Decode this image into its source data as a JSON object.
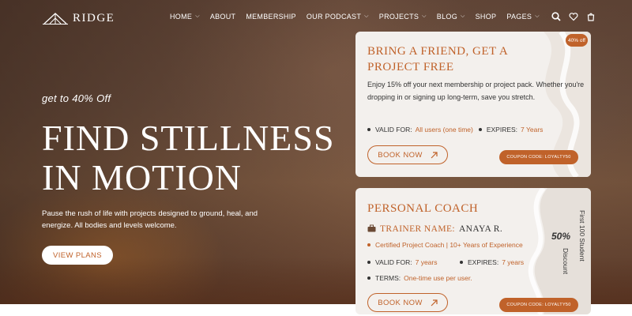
{
  "brand": {
    "name": "RIDGE"
  },
  "nav": [
    {
      "label": "HOME",
      "dropdown": true
    },
    {
      "label": "ABOUT",
      "dropdown": false
    },
    {
      "label": "MEMBERSHIP",
      "dropdown": false
    },
    {
      "label": "OUR PODCAST",
      "dropdown": true
    },
    {
      "label": "PROJECTS",
      "dropdown": true
    },
    {
      "label": "BLOG",
      "dropdown": true
    },
    {
      "label": "SHOP",
      "dropdown": false
    },
    {
      "label": "PAGES",
      "dropdown": true
    }
  ],
  "header_icons": [
    "search-icon",
    "heart-icon",
    "cart-icon"
  ],
  "hero": {
    "eyebrow": "get to 40% Off",
    "title_line1": "FIND STILLNESS",
    "title_line2": "IN MOTION",
    "subtitle": "Pause the rush of life with projects designed to ground, heal, and energize. All bodies and levels welcome.",
    "cta": "VIEW PLANS"
  },
  "card1": {
    "badge": "40% off",
    "title_line1": "BRING A FRIEND, GET A",
    "title_line2": "PROJECT FREE",
    "text": "Enjoy 15% off your next membership or project pack. Whether you're dropping in or signing up long-term, save you stretch.",
    "valid_label": "VALID FOR:",
    "valid_value": "All users (one time)",
    "expires_label": "EXPIRES:",
    "expires_value": "7 Years",
    "button": "BOOK NOW",
    "coupon": "COUPON CODE: LOYALTY50"
  },
  "card2": {
    "title": "PERSONAL COACH",
    "trainer_label": "TRAINER NAME:",
    "trainer_name": "ANAYA R.",
    "credential": "Certified Project Coach | 10+ Years of Experience",
    "valid_label": "VALID FOR:",
    "valid_value": "7 years",
    "expires_label": "EXPIRES:",
    "expires_value": "7 years",
    "terms_label": "TERMS:",
    "terms_value": "One-time use per user.",
    "discount_pct": "50%",
    "side_text1": "First 100 Student",
    "side_text2": "Discount",
    "button": "BOOK NOW",
    "coupon": "COUPON CODE: LOYALTY50"
  },
  "colors": {
    "accent": "#c0622a",
    "card_bg": "#f3f0ed"
  }
}
